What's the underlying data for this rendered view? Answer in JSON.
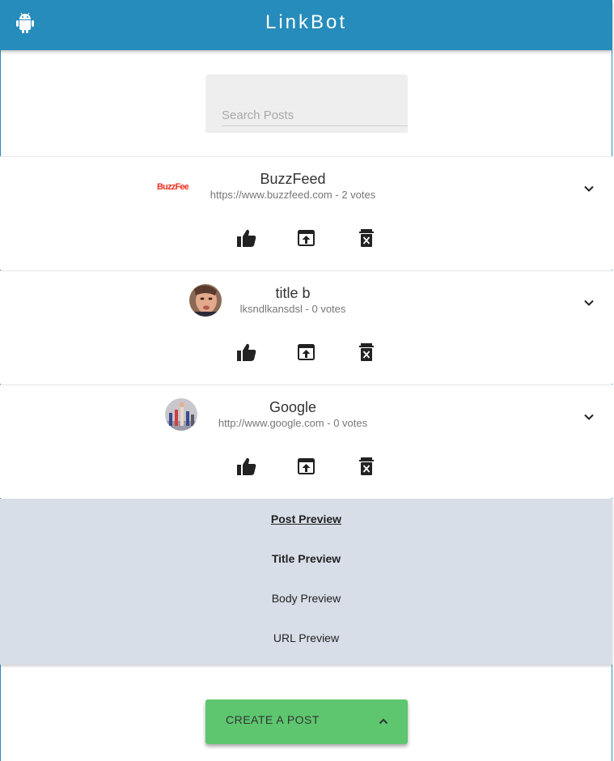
{
  "appbar": {
    "title": "LinkBot",
    "icon": "android-icon"
  },
  "search": {
    "placeholder": "Search Posts",
    "value": ""
  },
  "posts": [
    {
      "title": "BuzzFeed",
      "subtitle": "https://www.buzzfeed.com - 2 votes",
      "thumb_text": "BuzzFeed",
      "thumb_kind": "logo"
    },
    {
      "title": "title b",
      "subtitle": "lksndlkansdsl - 0 votes",
      "thumb_kind": "avatar-photo"
    },
    {
      "title": "Google",
      "subtitle": "http://www.google.com - 0 votes",
      "thumb_kind": "avatar-photo"
    }
  ],
  "actions": [
    "thumbs-up-icon",
    "open-in-new-icon",
    "delete-icon"
  ],
  "preview": {
    "heading": "Post Preview",
    "title": "Title Preview",
    "body": "Body Preview",
    "url": "URL Preview"
  },
  "create_button": {
    "label": "CREATE A POST"
  },
  "colors": {
    "appbar": "#268cbb",
    "preview_bg": "#d8dee7",
    "create_button": "#5dc66f",
    "buzzfeed_red": "#ee3322"
  }
}
